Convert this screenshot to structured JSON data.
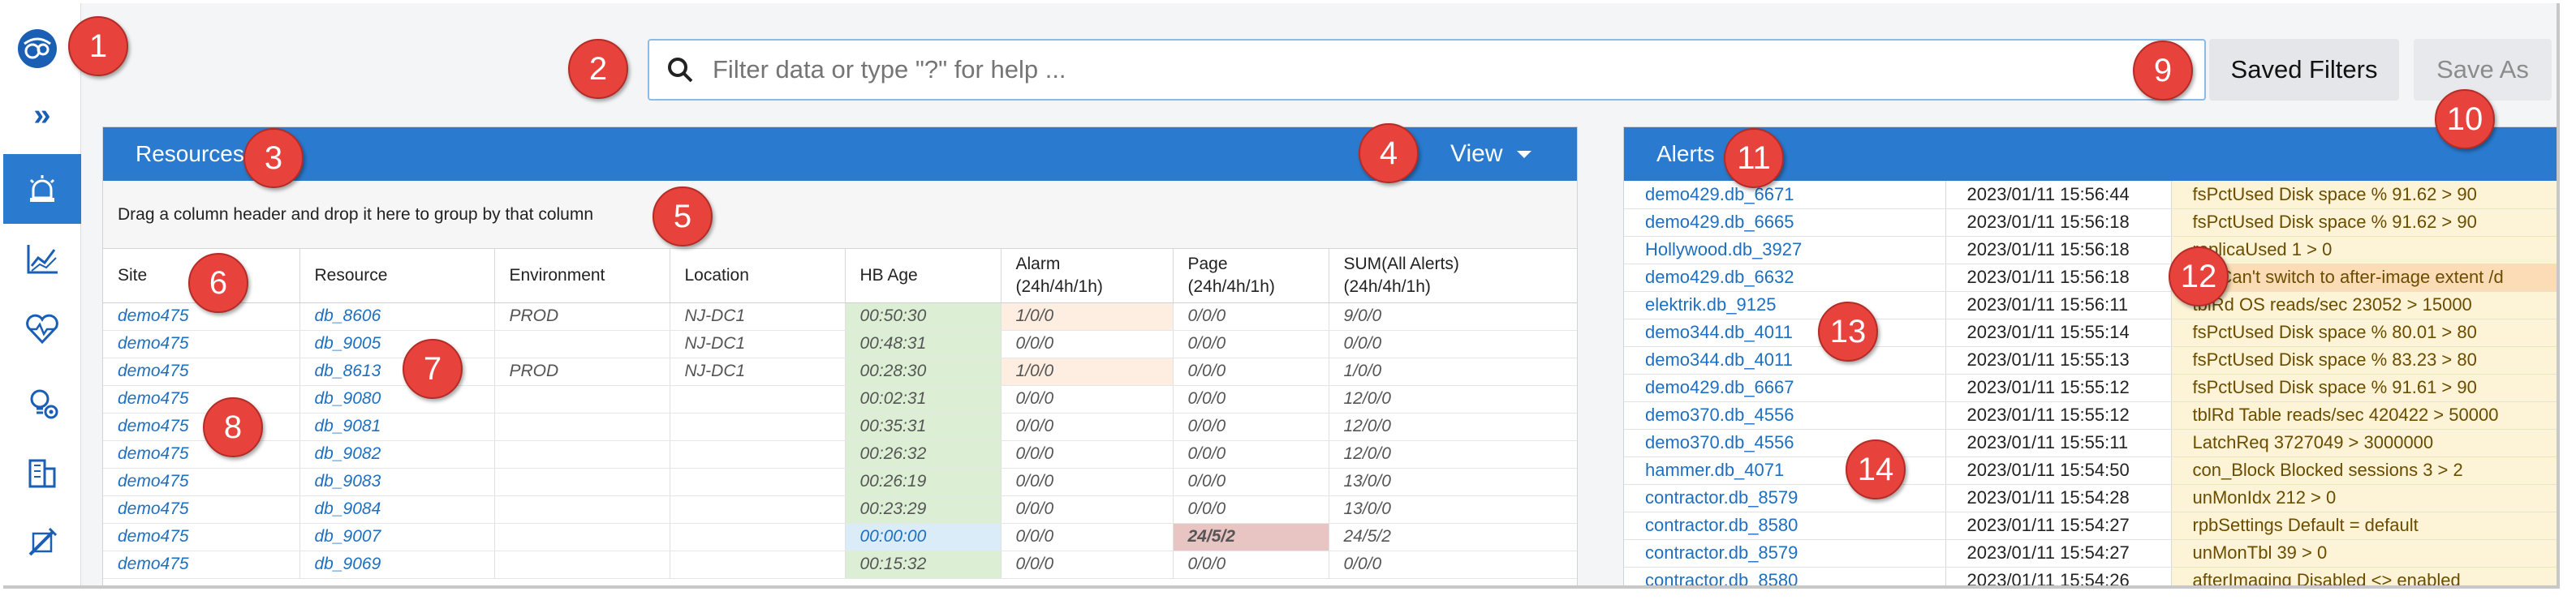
{
  "search": {
    "placeholder": "Filter data or type \"?\" for help ..."
  },
  "toolbar": {
    "saved_filters": "Saved Filters",
    "save_as": "Save As"
  },
  "sidebar": {
    "expand_glyph": "»",
    "items": [
      {
        "icon": "alert-siren-icon",
        "active": true
      },
      {
        "icon": "chart-trend-icon",
        "active": false
      },
      {
        "icon": "heart-pulse-icon",
        "active": false
      },
      {
        "icon": "settings-lightbulb-icon",
        "active": false
      },
      {
        "icon": "buildings-icon",
        "active": false
      },
      {
        "icon": "tools-icon",
        "active": false
      }
    ]
  },
  "resources": {
    "title": "Resources",
    "view_label": "View",
    "group_hint": "Drag a column header and drop it here to group by that column",
    "columns": [
      "Site",
      "Resource",
      "Environment",
      "Location",
      "HB Age",
      "Alarm\n(24h/4h/1h)",
      "Page\n(24h/4h/1h)",
      "SUM(All Alerts)\n(24h/4h/1h)"
    ],
    "rows": [
      {
        "site": "demo475",
        "resource": "db_8606",
        "environment": "PROD",
        "location": "NJ-DC1",
        "hb_age": "00:50:30",
        "alarm": "1/0/0",
        "page": "0/0/0",
        "sum": "9/0/0",
        "alarm_state": "warn",
        "page_state": "",
        "hb_state": ""
      },
      {
        "site": "demo475",
        "resource": "db_9005",
        "environment": "",
        "location": "NJ-DC1",
        "hb_age": "00:48:31",
        "alarm": "0/0/0",
        "page": "0/0/0",
        "sum": "0/0/0",
        "alarm_state": "",
        "page_state": "",
        "hb_state": ""
      },
      {
        "site": "demo475",
        "resource": "db_8613",
        "environment": "PROD",
        "location": "NJ-DC1",
        "hb_age": "00:28:30",
        "alarm": "1/0/0",
        "page": "0/0/0",
        "sum": "1/0/0",
        "alarm_state": "warn",
        "page_state": "",
        "hb_state": ""
      },
      {
        "site": "demo475",
        "resource": "db_9080",
        "environment": "",
        "location": "",
        "hb_age": "00:02:31",
        "alarm": "0/0/0",
        "page": "0/0/0",
        "sum": "12/0/0",
        "alarm_state": "",
        "page_state": "",
        "hb_state": ""
      },
      {
        "site": "demo475",
        "resource": "db_9081",
        "environment": "",
        "location": "",
        "hb_age": "00:35:31",
        "alarm": "0/0/0",
        "page": "0/0/0",
        "sum": "12/0/0",
        "alarm_state": "",
        "page_state": "",
        "hb_state": ""
      },
      {
        "site": "demo475",
        "resource": "db_9082",
        "environment": "",
        "location": "",
        "hb_age": "00:26:32",
        "alarm": "0/0/0",
        "page": "0/0/0",
        "sum": "12/0/0",
        "alarm_state": "",
        "page_state": "",
        "hb_state": ""
      },
      {
        "site": "demo475",
        "resource": "db_9083",
        "environment": "",
        "location": "",
        "hb_age": "00:26:19",
        "alarm": "0/0/0",
        "page": "0/0/0",
        "sum": "13/0/0",
        "alarm_state": "",
        "page_state": "",
        "hb_state": ""
      },
      {
        "site": "demo475",
        "resource": "db_9084",
        "environment": "",
        "location": "",
        "hb_age": "00:23:29",
        "alarm": "0/0/0",
        "page": "0/0/0",
        "sum": "13/0/0",
        "alarm_state": "",
        "page_state": "",
        "hb_state": ""
      },
      {
        "site": "demo475",
        "resource": "db_9007",
        "environment": "",
        "location": "",
        "hb_age": "00:00:00",
        "alarm": "0/0/0",
        "page": "24/5/2",
        "sum": "24/5/2",
        "alarm_state": "",
        "page_state": "bad",
        "hb_state": "blue"
      },
      {
        "site": "demo475",
        "resource": "db_9069",
        "environment": "",
        "location": "",
        "hb_age": "00:15:32",
        "alarm": "0/0/0",
        "page": "0/0/0",
        "sum": "0/0/0",
        "alarm_state": "",
        "page_state": "",
        "hb_state": ""
      }
    ]
  },
  "alerts": {
    "title": "Alerts",
    "rows": [
      {
        "source": "demo429.db_6671",
        "time": "2023/01/11 15:56:44",
        "message": "fsPctUsed Disk space % 91.62 > 90",
        "highlight": false
      },
      {
        "source": "demo429.db_6665",
        "time": "2023/01/11 15:56:18",
        "message": "fsPctUsed Disk space % 91.62 > 90",
        "highlight": false
      },
      {
        "source": "Hollywood.db_3927",
        "time": "2023/01/11 15:56:18",
        "message": "replicaUsed 1 > 0",
        "highlight": false
      },
      {
        "source": "demo429.db_6632",
        "time": "2023/01/11 15:56:18",
        "message": "(5) Can't switch to after-image extent /d",
        "highlight": true
      },
      {
        "source": "elektrik.db_9125",
        "time": "2023/01/11 15:56:11",
        "message": "tblRd OS reads/sec 23052 > 15000",
        "highlight": false
      },
      {
        "source": "demo344.db_4011",
        "time": "2023/01/11 15:55:14",
        "message": "fsPctUsed Disk space % 80.01 > 80",
        "highlight": false
      },
      {
        "source": "demo344.db_4011",
        "time": "2023/01/11 15:55:13",
        "message": "fsPctUsed Disk space % 83.23 > 80",
        "highlight": false
      },
      {
        "source": "demo429.db_6667",
        "time": "2023/01/11 15:55:12",
        "message": "fsPctUsed Disk space % 91.61 > 90",
        "highlight": false
      },
      {
        "source": "demo370.db_4556",
        "time": "2023/01/11 15:55:12",
        "message": "tblRd Table reads/sec 420422 > 50000",
        "highlight": false
      },
      {
        "source": "demo370.db_4556",
        "time": "2023/01/11 15:55:11",
        "message": "LatchReq 3727049 > 3000000",
        "highlight": false
      },
      {
        "source": "hammer.db_4071",
        "time": "2023/01/11 15:54:50",
        "message": "con_Block Blocked sessions 3 > 2",
        "highlight": false
      },
      {
        "source": "contractor.db_8579",
        "time": "2023/01/11 15:54:28",
        "message": "unMonIdx 212 > 0",
        "highlight": false
      },
      {
        "source": "contractor.db_8580",
        "time": "2023/01/11 15:54:27",
        "message": "rpbSettings Default = default",
        "highlight": false
      },
      {
        "source": "contractor.db_8579",
        "time": "2023/01/11 15:54:27",
        "message": "unMonTbl 39 > 0",
        "highlight": false
      },
      {
        "source": "contractor.db_8580",
        "time": "2023/01/11 15:54:26",
        "message": "afterImaging Disabled <> enabled",
        "highlight": false
      }
    ]
  },
  "callouts": [
    "1",
    "2",
    "3",
    "4",
    "5",
    "6",
    "7",
    "8",
    "9",
    "10",
    "11",
    "12",
    "13",
    "14"
  ],
  "colors": {
    "accent": "#2a7bd0",
    "callout": "#e8423c",
    "hb_ok": "#dcefd5",
    "hb_current": "#d9ecf7",
    "alarm_warn": "#fdeee1",
    "page_bad": "#e8c4c2",
    "alert_message": "#fdf3d6"
  }
}
